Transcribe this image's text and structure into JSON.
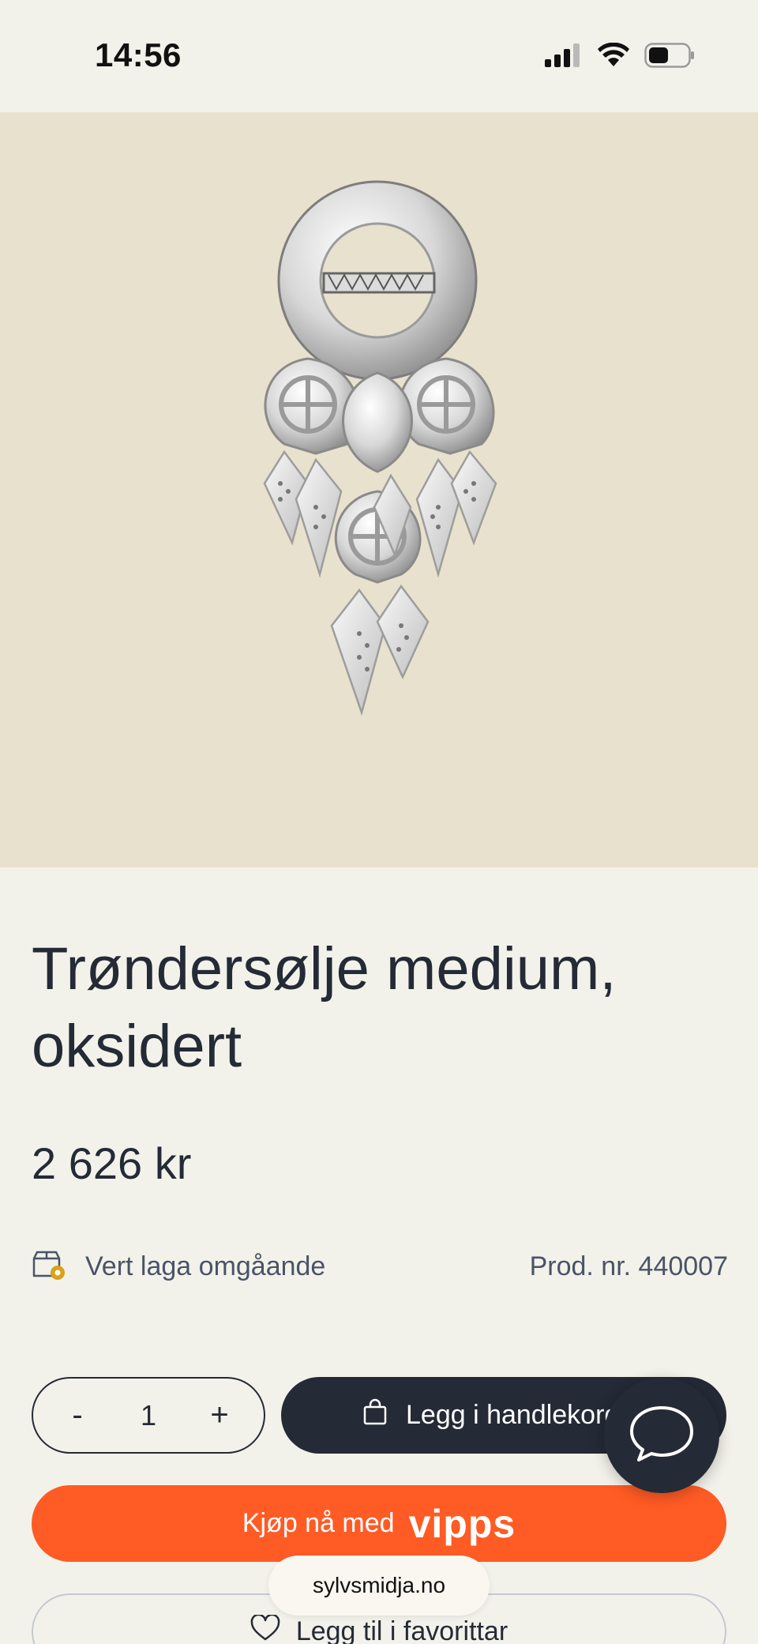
{
  "status_bar": {
    "time": "14:56",
    "icons": [
      "signal-icon",
      "wifi-icon",
      "battery-icon"
    ]
  },
  "product": {
    "image_icon": "silver-brooch-image",
    "title": "Trøndersølje medium, oksidert",
    "price": "2 626 kr",
    "delivery": "Vert laga omgåande",
    "product_number": "Prod. nr. 440007"
  },
  "actions": {
    "quantity_minus": "-",
    "quantity_value": "1",
    "quantity_plus": "+",
    "add_to_cart": "Legg i handlekorg",
    "vipps_label": "Kjøp nå med",
    "vipps_logo": "vipps",
    "favourite": "Legg til i favorittar"
  },
  "browser": {
    "url": "sylvsmidja.no"
  },
  "colors": {
    "background": "#f3f2ea",
    "image_background": "#e8e1cd",
    "primary_dark": "#242a36",
    "vipps_orange": "#ff5b24",
    "delivery_badge": "#d9a21b"
  }
}
